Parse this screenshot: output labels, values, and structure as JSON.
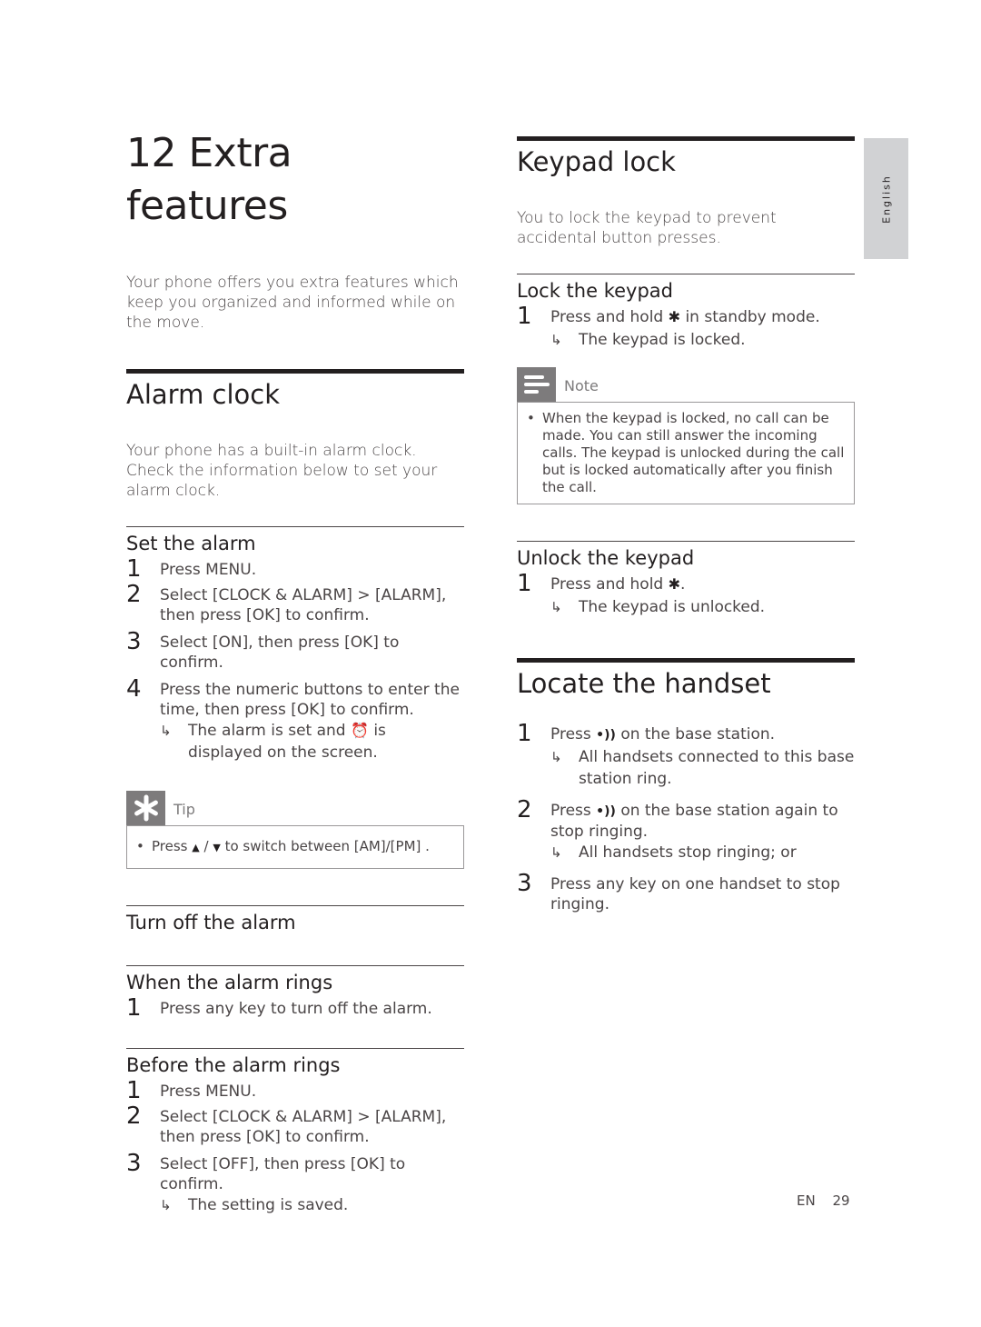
{
  "chapter": {
    "number": "12",
    "title": "Extra features",
    "intro": "Your phone offers you extra features which keep you organized and informed while on the move."
  },
  "language_tab": "English",
  "alarm_clock": {
    "title": "Alarm clock",
    "intro": "Your phone has a built-in alarm clock. Check the information below to set your alarm clock.",
    "set_alarm": {
      "title": "Set the alarm",
      "steps": [
        {
          "num": "1",
          "text": "Press MENU."
        },
        {
          "num": "2",
          "text": "Select [CLOCK & ALARM] > [ALARM], then press [OK] to confirm."
        },
        {
          "num": "3",
          "text": "Select [ON], then press [OK] to confirm."
        },
        {
          "num": "4",
          "text": "Press the numeric buttons to enter the time, then press [OK] to confirm."
        }
      ],
      "result_before_icon": "The alarm is set and",
      "result_icon": "alarm-clock-icon",
      "result_after_icon": "is displayed on the screen."
    },
    "tip": {
      "label": "Tip",
      "icon": "asterisk-icon",
      "text_before": "Press",
      "icon_up": "up-arrow-icon",
      "separator": "/",
      "icon_down": "down-arrow-icon",
      "text_after": "to switch between [AM]/[PM] ."
    },
    "turn_off": {
      "title": "Turn off the alarm"
    },
    "when_rings": {
      "title": "When the alarm rings",
      "steps": [
        {
          "num": "1",
          "text": "Press any key to turn off the alarm."
        }
      ]
    },
    "before_rings": {
      "title": "Before the alarm rings",
      "steps": [
        {
          "num": "1",
          "text": "Press MENU."
        },
        {
          "num": "2",
          "text": "Select [CLOCK & ALARM] > [ALARM], then press [OK] to confirm."
        },
        {
          "num": "3",
          "text": "Select [OFF], then press [OK] to confirm."
        }
      ],
      "result": "The setting is saved."
    }
  },
  "keypad_lock": {
    "title": "Keypad lock",
    "intro": "You to lock the keypad to prevent accidental button presses.",
    "lock": {
      "title": "Lock the keypad",
      "step_num": "1",
      "step_before": "Press and hold",
      "step_icon": "star-key-lock-icon",
      "step_after": "in standby mode.",
      "result": "The keypad is locked."
    },
    "note": {
      "label": "Note",
      "icon": "note-lines-icon",
      "text": "When the keypad is locked, no call can be made. You can still answer the incoming calls. The keypad is unlocked during the call but is locked automatically after you finish the call."
    },
    "unlock": {
      "title": "Unlock the keypad",
      "step_num": "1",
      "step_before": "Press and hold",
      "step_icon": "star-key-lock-icon",
      "step_after": ".",
      "result": "The keypad is unlocked."
    }
  },
  "locate": {
    "title": "Locate the handset",
    "steps": [
      {
        "num": "1",
        "before": "Press",
        "icon": "paging-icon",
        "after": "on the base station.",
        "result": "All handsets connected to this base station ring."
      },
      {
        "num": "2",
        "before": "Press",
        "icon": "paging-icon",
        "after": "on the base station again to stop ringing.",
        "result": "All handsets stop ringing; or"
      },
      {
        "num": "3",
        "text": "Press any key on one handset to stop ringing."
      }
    ]
  },
  "footer": {
    "lang": "EN",
    "page": "29"
  },
  "glyphs": {
    "arrow": "↳",
    "bullet": "•",
    "star_key": "✱",
    "paging": "•))",
    "alarm": "⏰",
    "up": "▲",
    "down": "▼"
  }
}
